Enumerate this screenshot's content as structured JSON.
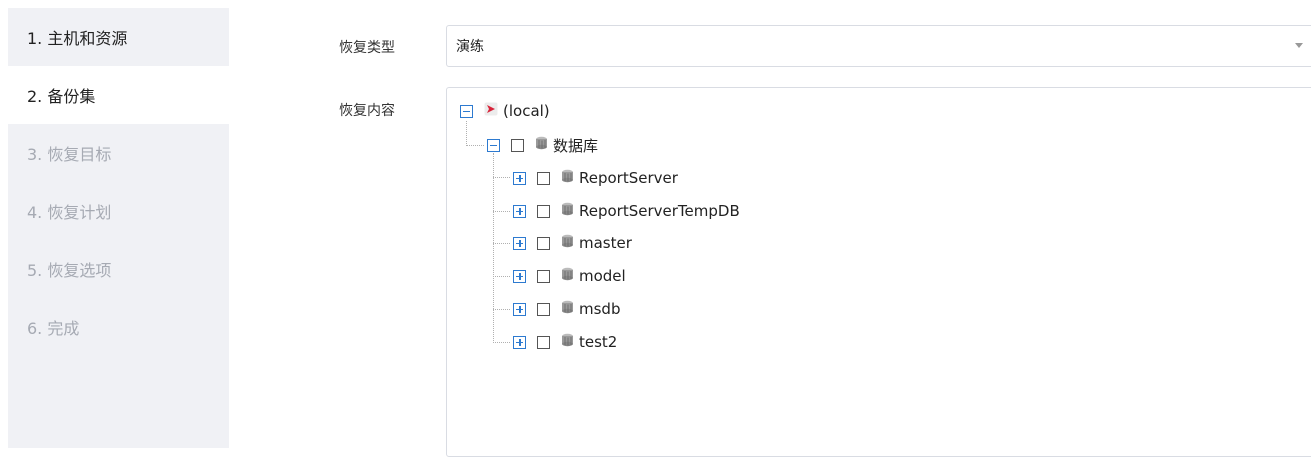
{
  "steps": [
    {
      "label": "1. 主机和资源"
    },
    {
      "label": "2. 备份集"
    },
    {
      "label": "3. 恢复目标"
    },
    {
      "label": "4. 恢复计划"
    },
    {
      "label": "5. 恢复选项"
    },
    {
      "label": "6. 完成"
    }
  ],
  "form": {
    "restore_type_label": "恢复类型",
    "restore_type_value": "演练",
    "restore_content_label": "恢复内容"
  },
  "tree": {
    "root": {
      "label": "(local)",
      "icon": "server-icon",
      "expanded": true
    },
    "databases": {
      "label": "数据库",
      "icon": "database-icon",
      "expanded": true,
      "checked": false
    },
    "items": [
      {
        "label": "ReportServer",
        "expanded": false,
        "checked": false
      },
      {
        "label": "ReportServerTempDB",
        "expanded": false,
        "checked": false
      },
      {
        "label": "master",
        "expanded": false,
        "checked": false
      },
      {
        "label": "model",
        "expanded": false,
        "checked": false
      },
      {
        "label": "msdb",
        "expanded": false,
        "checked": false
      },
      {
        "label": "test2",
        "expanded": false,
        "checked": false
      }
    ]
  },
  "colors": {
    "accent": "#2d7ad0",
    "sidebar_bg": "#f0f1f5",
    "disabled_text": "#a6aab3"
  }
}
